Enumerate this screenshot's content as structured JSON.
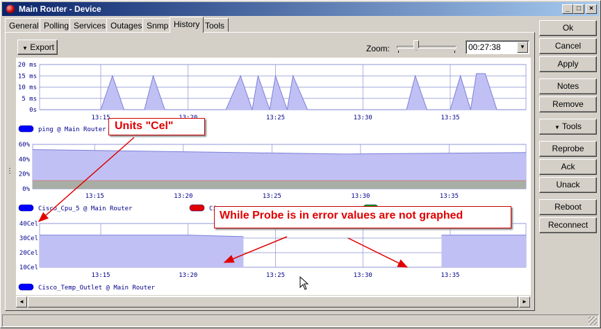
{
  "window": {
    "title": "Main Router - Device"
  },
  "tabs": [
    {
      "label": "General",
      "active": false
    },
    {
      "label": "Polling",
      "active": false
    },
    {
      "label": "Services",
      "active": false
    },
    {
      "label": "Outages",
      "active": false
    },
    {
      "label": "Snmp",
      "active": false
    },
    {
      "label": "History",
      "active": true
    },
    {
      "label": "Tools",
      "active": false
    }
  ],
  "toolbar": {
    "export_label": "Export",
    "zoom_label": "Zoom:",
    "zoom_value": "00:27:38"
  },
  "side_buttons": {
    "ok": "Ok",
    "cancel": "Cancel",
    "apply": "Apply",
    "notes": "Notes",
    "remove": "Remove",
    "tools": "Tools",
    "reprobe": "Reprobe",
    "ack": "Ack",
    "unack": "Unack",
    "reboot": "Reboot",
    "reconnect": "Reconnect"
  },
  "annotations": {
    "units": "Units \"Cel\"",
    "probe": "While Probe is in error values are not graphed"
  },
  "colors": {
    "series_blue": "#0000ff",
    "series_red": "#e00000",
    "series_green": "#00a000",
    "fill": "#c0c0f4",
    "stroke": "#7b7fd9",
    "annotation_red": "#e00000"
  },
  "chart_data": [
    {
      "type": "area",
      "x_ticks": [
        "13:15",
        "13:20",
        "13:25",
        "13:30",
        "13:35"
      ],
      "y_ticks": [
        "20 ms",
        "15 ms",
        "10 ms",
        "5 ms",
        "0s"
      ],
      "ylim": [
        0,
        20
      ],
      "y_unit": "ms",
      "series": [
        {
          "name": "ping @ Main Router",
          "color": "#0000ff",
          "points": [
            [
              "13:11:30",
              0
            ],
            [
              "13:15:00",
              0
            ],
            [
              "13:15:40",
              15
            ],
            [
              "13:16:20",
              0
            ],
            [
              "13:17:30",
              0
            ],
            [
              "13:18:00",
              15
            ],
            [
              "13:18:40",
              0
            ],
            [
              "13:22:10",
              0
            ],
            [
              "13:23:00",
              15
            ],
            [
              "13:23:40",
              0
            ],
            [
              "13:24:00",
              15
            ],
            [
              "13:24:40",
              0
            ],
            [
              "13:25:00",
              15
            ],
            [
              "13:25:40",
              0
            ],
            [
              "13:26:00",
              15
            ],
            [
              "13:26:50",
              0
            ],
            [
              "13:32:30",
              0
            ],
            [
              "13:33:00",
              15
            ],
            [
              "13:33:40",
              0
            ],
            [
              "13:35:00",
              0
            ],
            [
              "13:35:35",
              15
            ],
            [
              "13:36:10",
              0
            ],
            [
              "13:36:30",
              16
            ],
            [
              "13:37:00",
              16
            ],
            [
              "13:37:40",
              0
            ],
            [
              "13:39:20",
              0
            ]
          ]
        }
      ]
    },
    {
      "type": "area",
      "x_ticks": [
        "13:15",
        "13:20",
        "13:25",
        "13:30",
        "13:35"
      ],
      "y_ticks": [
        "60%",
        "40%",
        "20%",
        "0%"
      ],
      "ylim": [
        0,
        60
      ],
      "y_unit": "%",
      "series": [
        {
          "name": "Cisco_Cpu_5 @ Main Router",
          "color": "#0000ff",
          "points": [
            [
              "13:11:30",
              53
            ],
            [
              "13:20:00",
              50
            ],
            [
              "13:29:00",
              47
            ],
            [
              "13:39:20",
              49
            ]
          ]
        },
        {
          "name": "",
          "color": "#e00000",
          "points": [
            [
              "13:11:30",
              11
            ],
            [
              "13:39:20",
              11
            ]
          ]
        },
        {
          "name": "",
          "color": "#00a000",
          "points": [
            [
              "13:11:30",
              11
            ],
            [
              "13:39:20",
              11
            ]
          ]
        }
      ],
      "legend_labels": [
        "Cisco_Cpu_5 @ Main Router",
        "Ci",
        ""
      ]
    },
    {
      "type": "area",
      "x_ticks": [
        "13:15",
        "13:20",
        "13:25",
        "13:30",
        "13:35"
      ],
      "y_ticks": [
        "40Cel",
        "30Cel",
        "20Cel",
        "10Cel"
      ],
      "ylim": [
        10,
        40
      ],
      "y_unit": "Cel",
      "series": [
        {
          "name": "Cisco_Temp_Outlet @ Main Router",
          "color": "#0000ff",
          "segments": [
            [
              [
                "13:11:30",
                32
              ],
              [
                "13:20:00",
                32
              ],
              [
                "13:23:10",
                31
              ]
            ],
            [
              [
                "13:34:30",
                32
              ],
              [
                "13:39:20",
                32
              ]
            ]
          ]
        }
      ]
    }
  ]
}
